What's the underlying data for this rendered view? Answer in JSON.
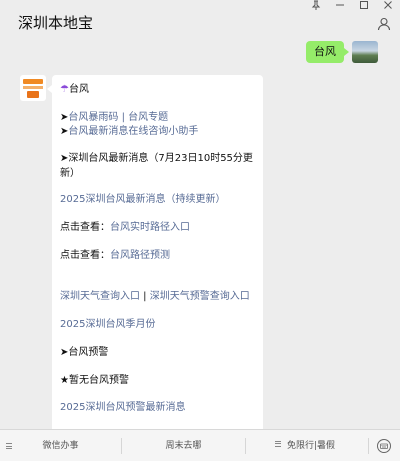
{
  "header": {
    "title": "深圳本地宝",
    "window_controls": [
      "pin-icon",
      "minimize-icon",
      "maximize-icon",
      "close-icon"
    ],
    "profile_icon": "person-icon"
  },
  "outgoing": {
    "text": "台风",
    "bubble_color": "#95ec69"
  },
  "incoming": {
    "umbrella_icon": "umbrella-icon",
    "heading": "台风",
    "arrow1": "➤",
    "link_rain": "台风暴雨码",
    "sep1": " | ",
    "link_topic": "台风专题",
    "arrow2": "➤",
    "link_assistant": "台风最新消息在线咨询小助手",
    "latest_news": "➤深圳台风最新消息（7月23日10时55分更新）",
    "link_2025_latest": "2025深圳台风最新消息（持续更新）",
    "view_prefix1": "点击查看：",
    "link_realtime_path": "台风实时路径入口",
    "view_prefix2": "点击查看：",
    "link_path_forecast": "台风路径预测",
    "link_weather_query": "深圳天气查询入口",
    "sep2": " | ",
    "link_warning_query": "深圳天气预警查询入口",
    "link_season_months": "2025深圳台风季月份",
    "warning_heading": "➤台风预警",
    "no_warning": "★暂无台风预警",
    "link_2025_warning": "2025深圳台风预警最新消息",
    "link_color": "#576b95"
  },
  "bottom_menu": {
    "items": [
      "微信办事",
      "周末去哪",
      "免限行|暑假"
    ],
    "menu_icon": "menu-icon",
    "keyboard_icon": "keyboard-icon"
  }
}
